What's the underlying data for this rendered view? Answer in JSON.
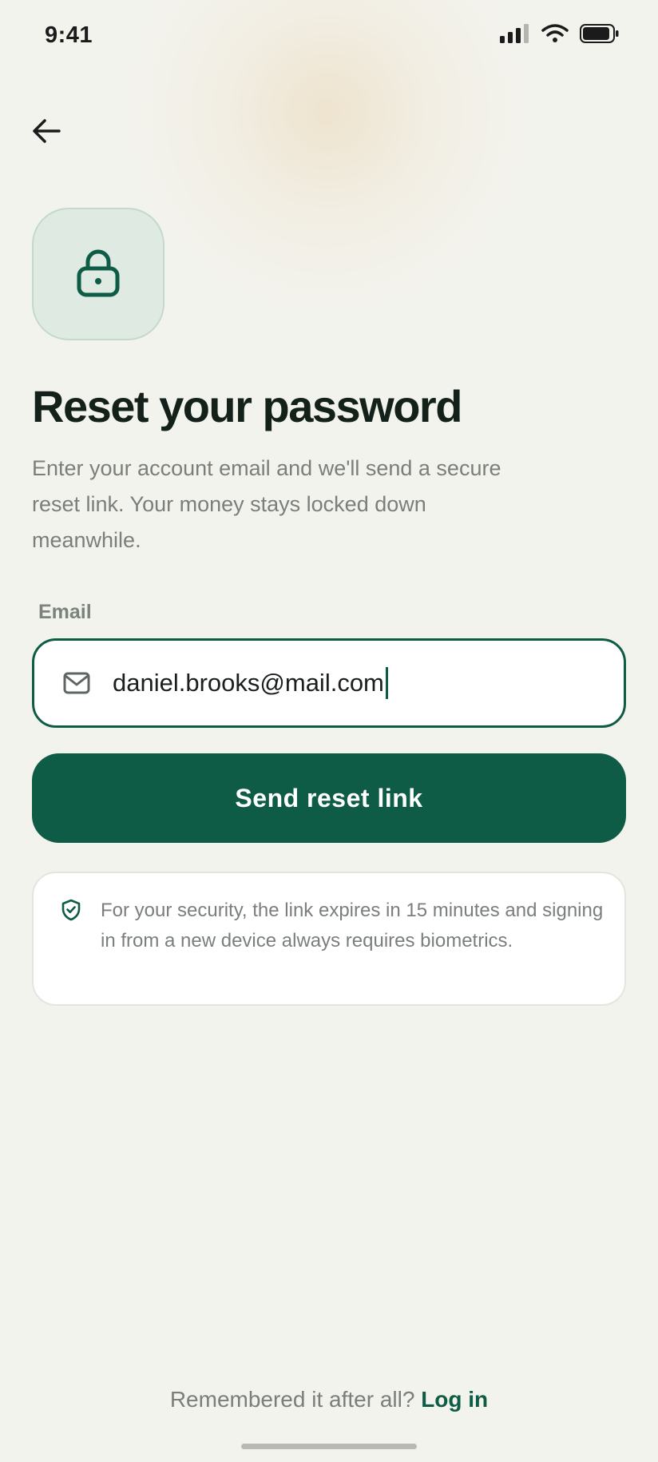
{
  "status_bar": {
    "time": "9:41"
  },
  "header": {
    "back_icon": "arrow-left-icon"
  },
  "hero": {
    "icon": "lock-icon",
    "title": "Reset your password",
    "subtitle": "Enter your account email and we'll send a secure reset link. Your money stays locked down meanwhile."
  },
  "form": {
    "email_label": "Email",
    "email_icon": "mail-icon",
    "email_value": "daniel.brooks@mail.com",
    "submit_label": "Send reset link"
  },
  "security_note": {
    "icon": "shield-check-icon",
    "text": "For your security, the link expires in 15 minutes and signing in from a new device always requires biometrics."
  },
  "footer": {
    "prompt": "Remembered it after all?",
    "link_label": "Log in"
  },
  "colors": {
    "accent": "#0f5c46",
    "background": "#f3f3ee",
    "tile": "#dfeae2"
  }
}
